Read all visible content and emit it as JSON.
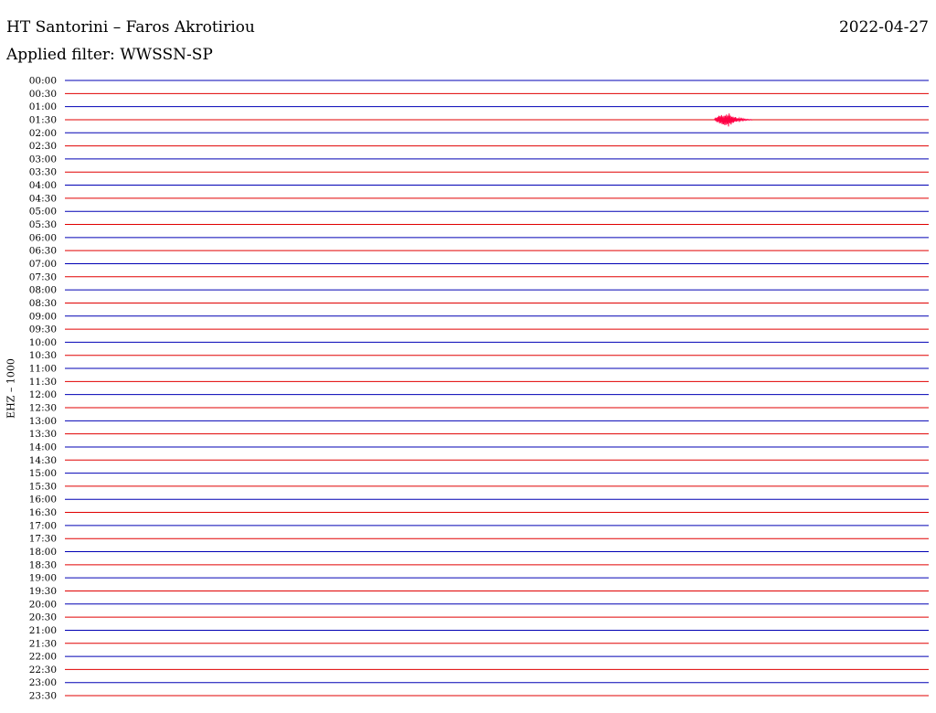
{
  "header": {
    "station": "HT Santorini – Faros Akrotiriou",
    "date": "2022-04-27",
    "filter": "Applied filter: WWSSN-SP"
  },
  "channel_label": "EHZ – 1000",
  "chart_data": {
    "type": "line",
    "title": "HT Santorini – Faros Akrotiriou",
    "subtitle": "Applied filter: WWSSN-SP",
    "ylabel": "EHZ – 1000",
    "xlabel": "",
    "x_range_fraction": [
      0,
      1
    ],
    "row_labels": [
      "00:00",
      "00:30",
      "01:00",
      "01:30",
      "02:00",
      "02:30",
      "03:00",
      "03:30",
      "04:00",
      "04:30",
      "05:00",
      "05:30",
      "06:00",
      "06:30",
      "07:00",
      "07:30",
      "08:00",
      "08:30",
      "09:00",
      "09:30",
      "10:00",
      "10:30",
      "11:00",
      "11:30",
      "12:00",
      "12:30",
      "13:00",
      "13:30",
      "14:00",
      "14:30",
      "15:00",
      "15:30",
      "16:00",
      "16:30",
      "17:00",
      "17:30",
      "18:00",
      "18:30",
      "19:00",
      "19:30",
      "20:00",
      "20:30",
      "21:00",
      "21:30",
      "22:00",
      "22:30",
      "23:00",
      "23:30"
    ],
    "trace_colors": [
      "#0000b4",
      "#e00000"
    ],
    "event_color": "#ff0044",
    "events": [
      {
        "row_label": "01:30",
        "start_fraction": 0.752,
        "end_fraction": 0.795,
        "peak_fraction": 0.768,
        "peak_amplitude_rows": 0.55
      }
    ],
    "grid": false,
    "legend": "none"
  }
}
